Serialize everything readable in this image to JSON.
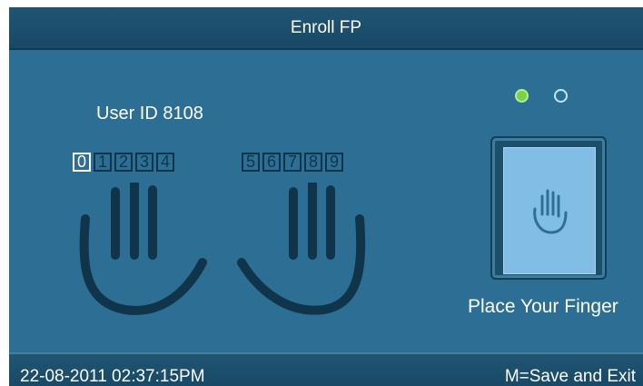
{
  "title": "Enroll FP",
  "user_id": "User ID 8108",
  "fingers": {
    "left": [
      "0",
      "1",
      "2",
      "3",
      "4"
    ],
    "right": [
      "5",
      "6",
      "7",
      "8",
      "9"
    ],
    "selected": "0"
  },
  "progress": {
    "captured": 1,
    "required": 2
  },
  "prompt": "Place Your Finger",
  "status_bar": {
    "datetime": "22-08-2011  02:37:15PM",
    "hint": "M=Save and Exit"
  },
  "icons": {
    "left_hand": "hand-outline-icon",
    "right_hand": "hand-outline-icon",
    "scanner": "hand-scan-icon"
  },
  "colors": {
    "background": "#2d6f94",
    "bar": "#1f5573",
    "progress_done": "#7cd14a",
    "scanner_pad": "#82bde6"
  }
}
